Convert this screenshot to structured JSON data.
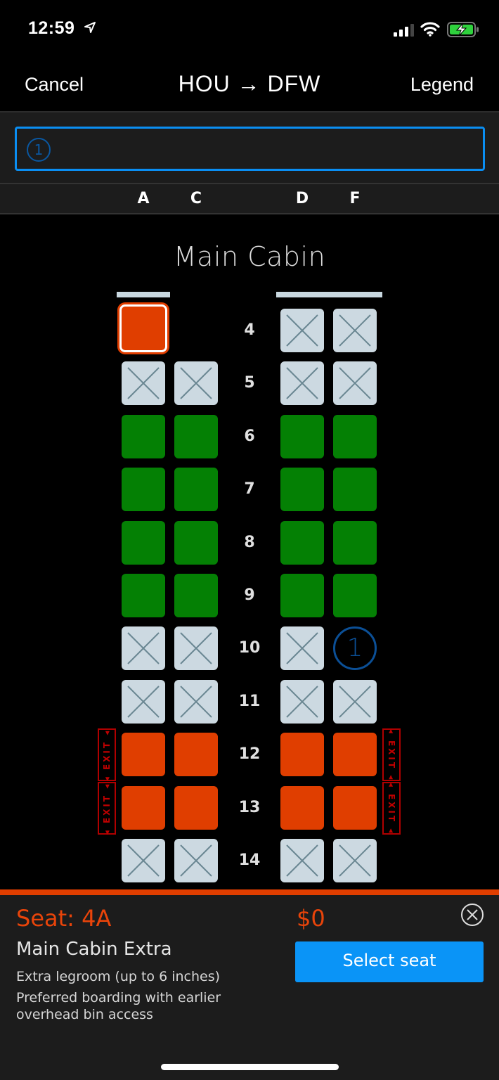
{
  "status_bar": {
    "time": "12:59",
    "location_icon": "location-arrow-icon",
    "signal_icon": "cellular-signal-icon",
    "wifi_icon": "wifi-icon",
    "battery_icon": "battery-charging-icon"
  },
  "nav": {
    "cancel_label": "Cancel",
    "title": "HOU → DFW",
    "legend_label": "Legend"
  },
  "passenger_selector": {
    "passenger_badge": "1"
  },
  "columns": [
    "A",
    "C",
    "D",
    "F"
  ],
  "cabin": {
    "title": "Main Cabin",
    "rows": [
      {
        "number": "4",
        "seats": {
          "A": "selected",
          "C": "none",
          "D": "occupied",
          "F": "occupied"
        }
      },
      {
        "number": "5",
        "seats": {
          "A": "occupied",
          "C": "occupied",
          "D": "occupied",
          "F": "occupied"
        }
      },
      {
        "number": "6",
        "seats": {
          "A": "preferred",
          "C": "preferred",
          "D": "preferred",
          "F": "preferred"
        }
      },
      {
        "number": "7",
        "seats": {
          "A": "preferred",
          "C": "preferred",
          "D": "preferred",
          "F": "preferred"
        }
      },
      {
        "number": "8",
        "seats": {
          "A": "preferred",
          "C": "preferred",
          "D": "preferred",
          "F": "preferred"
        }
      },
      {
        "number": "9",
        "seats": {
          "A": "preferred",
          "C": "preferred",
          "D": "preferred",
          "F": "preferred"
        }
      },
      {
        "number": "10",
        "seats": {
          "A": "occupied",
          "C": "occupied",
          "D": "occupied",
          "F": "assigned"
        }
      },
      {
        "number": "11",
        "seats": {
          "A": "occupied",
          "C": "occupied",
          "D": "occupied",
          "F": "occupied"
        }
      },
      {
        "number": "12",
        "seats": {
          "A": "extra",
          "C": "extra",
          "D": "extra",
          "F": "extra"
        },
        "exit": true
      },
      {
        "number": "13",
        "seats": {
          "A": "extra",
          "C": "extra",
          "D": "extra",
          "F": "extra"
        },
        "exit": true
      },
      {
        "number": "14",
        "seats": {
          "A": "occupied",
          "C": "occupied",
          "D": "occupied",
          "F": "occupied"
        }
      }
    ],
    "assigned_passenger_badge": "1",
    "exit_label": "EXIT"
  },
  "seat_colors": {
    "occupied": "#ccd9e1",
    "preferred": "#048004",
    "extra": "#e03e00",
    "assigned": "#0b4f96",
    "accent": "#0a94f7"
  },
  "details": {
    "seat_label": "Seat: 4A",
    "price": "$0",
    "seat_type": "Main Cabin Extra",
    "features": [
      "Extra legroom (up to 6 inches)",
      "Preferred boarding with earlier",
      "overhead bin access"
    ],
    "select_button": "Select seat"
  }
}
